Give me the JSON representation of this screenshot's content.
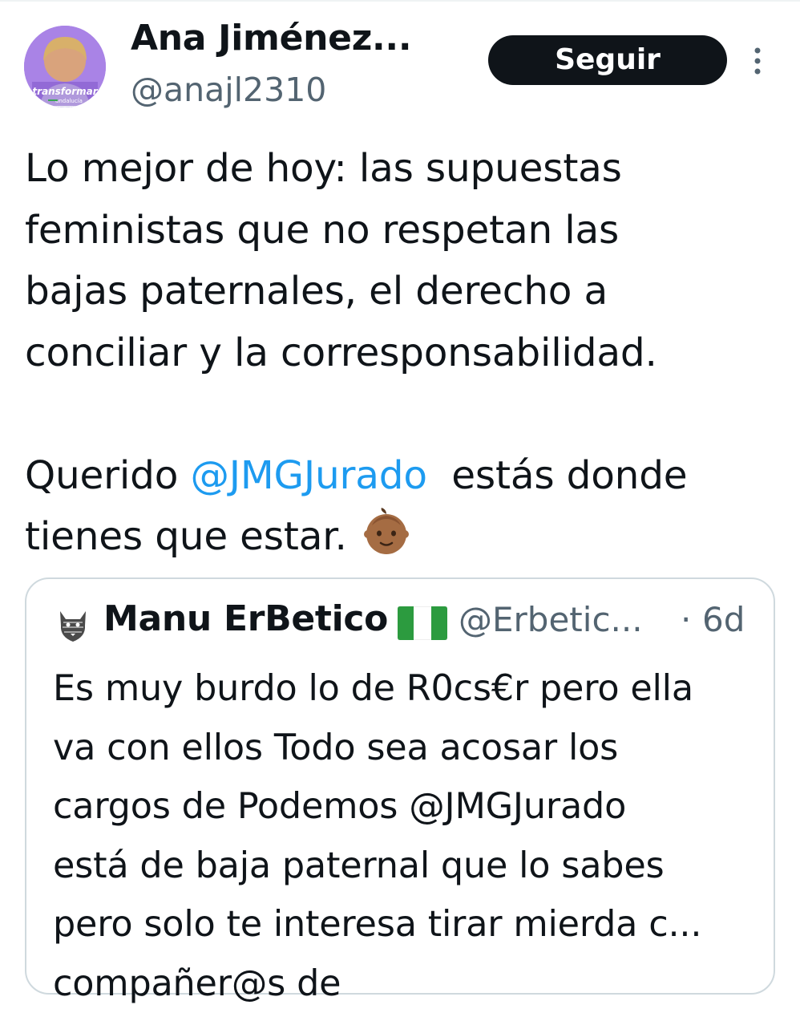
{
  "tweet": {
    "author_name": "Ana Jiménez...",
    "author_handle": "@anajl2310",
    "avatar_caption": "transformar andalucía",
    "follow_label": "Seguir",
    "text_lines": [
      "Lo mejor de hoy: las supuestas",
      "feministas que no respetan las",
      "bajas paternales, el derecho a",
      "conciliar y la corresponsabilidad."
    ],
    "text_line5_before": "Querido ",
    "mention": "@JMGJurado",
    "text_line5_after": "  estás donde",
    "text_line6": "tienes que estar.",
    "emoji": "baby-emoji"
  },
  "quote": {
    "author_name": "Manu ErBetico",
    "author_handle": "@Erbetic...",
    "separator": "·",
    "time": "6d",
    "flag": "andalusia-flag",
    "text_lines": [
      "Es muy burdo lo de R0cs€r pero ella",
      "va con ellos Todo sea acosar los",
      "cargos de Podemos @JMGJurado",
      "está de baja paternal que lo sabes",
      "pero solo te interesa tirar mierda c...",
      "compañer@s de"
    ]
  },
  "colors": {
    "text": "#0f1419",
    "secondary": "#536471",
    "link": "#1d9bf0",
    "button_bg": "#0f1419",
    "button_text": "#ffffff",
    "border": "#cfd9de",
    "avatar_bg": "#a27fe0",
    "flag_green": "#2c9b3f"
  }
}
